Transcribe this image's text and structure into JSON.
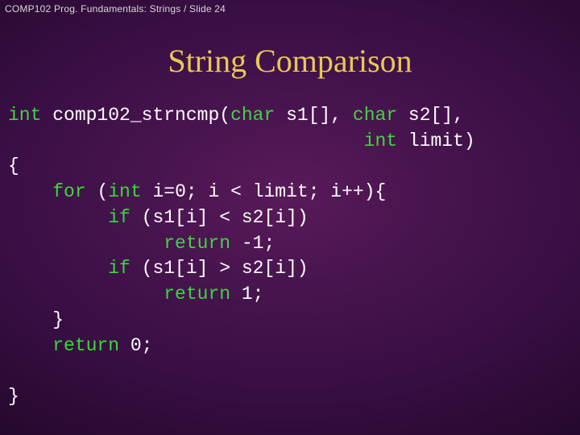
{
  "header": "COMP102 Prog. Fundamentals: Strings / Slide 24",
  "title": "String Comparison",
  "code": {
    "l1a": "int",
    "l1b": " comp102_strncmp(",
    "l1c": "char",
    "l1d": " s1[], ",
    "l1e": "char",
    "l1f": " s2[],",
    "l2a": "                                ",
    "l2b": "int",
    "l2c": " limit)",
    "l3": "{",
    "l4a": "    ",
    "l4b": "for",
    "l4c": " (",
    "l4d": "int",
    "l4e": " i=0; i < limit; i++){",
    "l5a": "         ",
    "l5b": "if",
    "l5c": " (s1[i] < s2[i])",
    "l6a": "              ",
    "l6b": "return",
    "l6c": " -1;",
    "l7a": "         ",
    "l7b": "if",
    "l7c": " (s1[i] > s2[i])",
    "l8a": "              ",
    "l8b": "return",
    "l8c": " 1;",
    "l9": "    }",
    "l10a": "    ",
    "l10b": "return",
    "l10c": " 0;",
    "l11": "}"
  }
}
